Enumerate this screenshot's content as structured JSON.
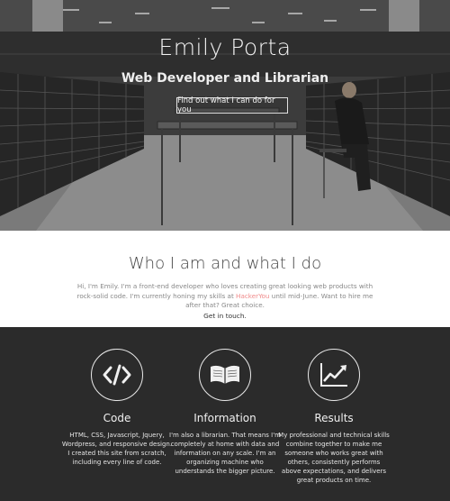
{
  "hero": {
    "title": "Emily Porta",
    "subtitle": "Web Developer and Librarian",
    "cta_label": "Find out what I can do for you"
  },
  "about": {
    "title": "Who I am and what I do",
    "text_before": "Hi, I'm Emily. I'm a front-end developer who loves creating great looking web products with rock-solid code. I'm currently honing my skills at ",
    "highlight": "HackerYou",
    "text_after": " until mid-June. Want to hire me after that? Great choice.",
    "contact": "Get in touch."
  },
  "skills": [
    {
      "icon": "code-brackets-icon",
      "heading": "Code",
      "desc": "HTML, CSS, Javascript, Jquery, Wordpress, and responsive design. I created this site from scratch, including every line of code."
    },
    {
      "icon": "open-book-icon",
      "heading": "Information",
      "desc": "I'm also a librarian. That means I'm completely at home with data and information on any scale. I'm an organizing machine who understands the bigger picture."
    },
    {
      "icon": "rising-chart-icon",
      "heading": "Results",
      "desc": "My professional and technical skills combine together to make me someone who works great with others, consistently performs above expectations, and delivers great products on time."
    }
  ],
  "colors": {
    "hero_bg": "#3a3a3a",
    "about_bg": "#ffffff",
    "skills_bg": "#2b2b2b",
    "highlight": "#f08a8a"
  }
}
